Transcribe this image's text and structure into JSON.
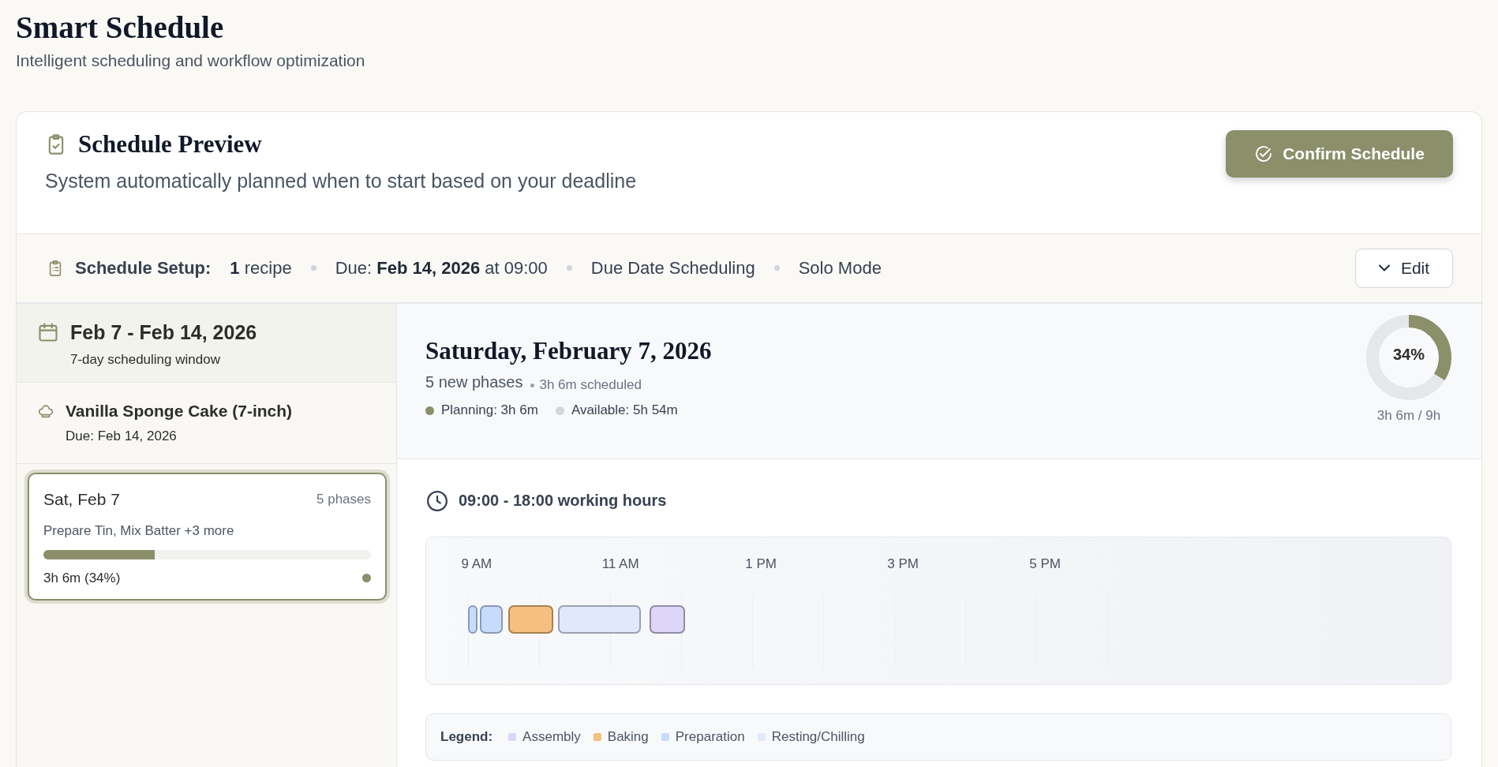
{
  "header": {
    "title": "Smart Schedule",
    "subtitle": "Intelligent scheduling and workflow optimization"
  },
  "preview": {
    "title": "Schedule Preview",
    "description": "System automatically planned when to start based on your deadline",
    "confirm_button": "Confirm Schedule"
  },
  "setup": {
    "label": "Schedule Setup:",
    "items": [
      "**1** recipe",
      "Due: **Feb 14, 2026** at 09:00",
      "Due Date Scheduling",
      "Solo Mode"
    ],
    "edit_button": "Edit"
  },
  "sidebar": {
    "range": {
      "title": "Feb 7 - Feb 14, 2026",
      "subtitle": "7-day scheduling window"
    },
    "recipes": [
      {
        "name": "Vanilla Sponge Cake (7-inch)",
        "due": "Due: Feb 14, 2026"
      }
    ],
    "days": [
      {
        "date": "Sat, Feb 7",
        "phase_count": "5 phases",
        "summary": "Prepare Tin, Mix Batter +3 more",
        "level": 0.34,
        "reading": "3h 6m (34%)",
        "selected": true,
        "color": "#8b8f6a"
      }
    ]
  },
  "day_view": {
    "title": "Saturday, February 7, 2026",
    "phase_count": "5 new phases",
    "scheduled": "3h 6m scheduled",
    "stats": [
      {
        "label": "Planning: 3h 6m",
        "color": "#8b8f6a"
      },
      {
        "label": "Available: 5h 54m",
        "color": "#d4d5da"
      }
    ],
    "usage": {
      "level": 0.34,
      "percent": "34%",
      "reading": "3h 6m / 9h"
    },
    "working_hours": "09:00 - 18:00 working hours",
    "timeline": {
      "hours": [
        "9 AM",
        "11 AM",
        "1 PM",
        "3 PM",
        "5 PM"
      ],
      "phases": [
        {
          "kind": "preparation"
        },
        {
          "kind": "preparation"
        },
        {
          "kind": "baking"
        },
        {
          "kind": "resting"
        },
        {
          "kind": "assembly"
        }
      ]
    },
    "legend": {
      "label": "Legend:",
      "items": [
        {
          "label": "Assembly",
          "color": "#ddd6fa"
        },
        {
          "label": "Baking",
          "color": "#f4bf80"
        },
        {
          "label": "Preparation",
          "color": "#c7dbfb"
        },
        {
          "label": "Resting/Chilling",
          "color": "#e2e8fc"
        }
      ]
    }
  }
}
